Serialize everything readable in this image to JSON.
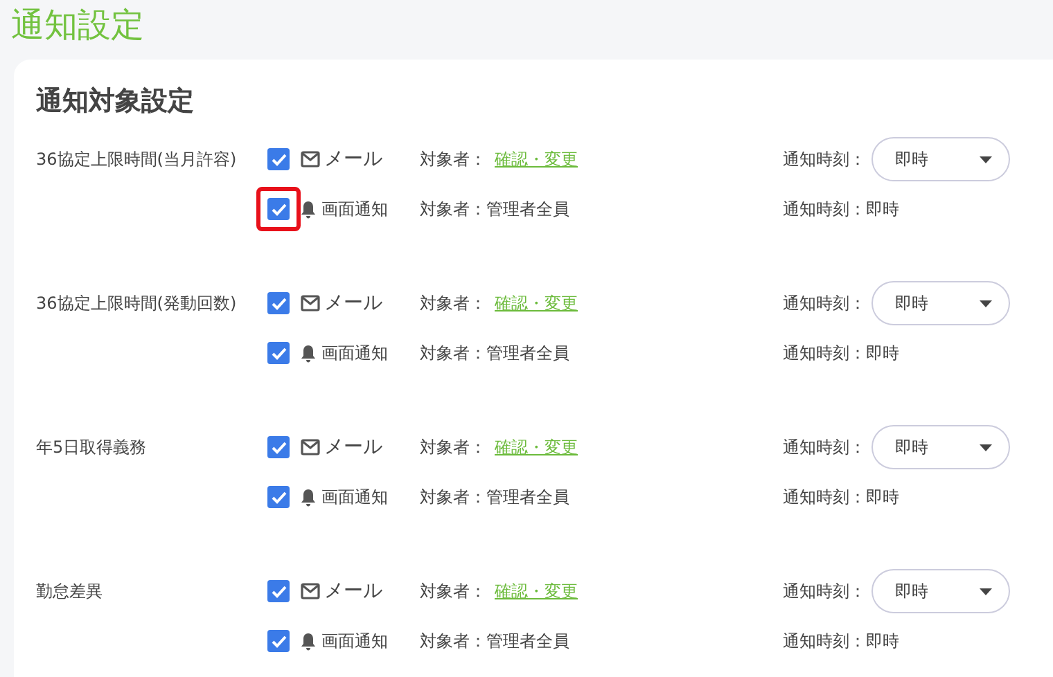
{
  "page_title": "通知設定",
  "card": {
    "title": "通知対象設定",
    "groups": [
      {
        "label": "36協定上限時間(当月許容)",
        "notifications": [
          {
            "kind": "mail",
            "label": "メール",
            "checked": true,
            "highlighted": false,
            "target_label": "対象者：",
            "target_link": "確認・変更",
            "time_label": "通知時刻：",
            "time_select": "即時"
          },
          {
            "kind": "screen",
            "label": "画面通知",
            "checked": true,
            "highlighted": true,
            "target_text": "対象者：管理者全員",
            "time_text": "通知時刻：即時"
          }
        ]
      },
      {
        "label": "36協定上限時間(発動回数)",
        "notifications": [
          {
            "kind": "mail",
            "label": "メール",
            "checked": true,
            "highlighted": false,
            "target_label": "対象者：",
            "target_link": "確認・変更",
            "time_label": "通知時刻：",
            "time_select": "即時"
          },
          {
            "kind": "screen",
            "label": "画面通知",
            "checked": true,
            "highlighted": false,
            "target_text": "対象者：管理者全員",
            "time_text": "通知時刻：即時"
          }
        ]
      },
      {
        "label": "年5日取得義務",
        "notifications": [
          {
            "kind": "mail",
            "label": "メール",
            "checked": true,
            "highlighted": false,
            "target_label": "対象者：",
            "target_link": "確認・変更",
            "time_label": "通知時刻：",
            "time_select": "即時"
          },
          {
            "kind": "screen",
            "label": "画面通知",
            "checked": true,
            "highlighted": false,
            "target_text": "対象者：管理者全員",
            "time_text": "通知時刻：即時"
          }
        ]
      },
      {
        "label": "勤怠差異",
        "notifications": [
          {
            "kind": "mail",
            "label": "メール",
            "checked": true,
            "highlighted": false,
            "target_label": "対象者：",
            "target_link": "確認・変更",
            "time_label": "通知時刻：",
            "time_select": "即時"
          },
          {
            "kind": "screen",
            "label": "画面通知",
            "checked": true,
            "highlighted": false,
            "target_text": "対象者：管理者全員",
            "time_text": "通知時刻：即時"
          }
        ]
      }
    ]
  }
}
